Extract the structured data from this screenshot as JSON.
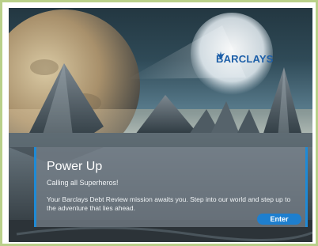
{
  "logo": {
    "text": "BARCLAYS",
    "icon": "eagle-icon",
    "color": "#1d5fa8"
  },
  "panel": {
    "title": "Power Up",
    "subtitle": "Calling all Superheros!",
    "body": "Your Barclays Debt Review mission awaits you. Step into our world and step up to the adventure that lies ahead.",
    "enter_label": "Enter",
    "accent_color": "#1e8ad6"
  }
}
